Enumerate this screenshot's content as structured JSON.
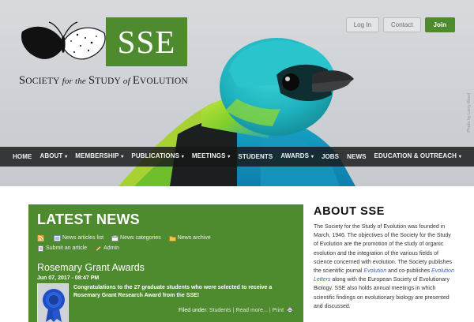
{
  "header": {
    "logo": {
      "abbr": "SSE",
      "tagline_parts": [
        "S",
        "OCIETY",
        " for the ",
        "S",
        "TUDY",
        " of ",
        "E",
        "VOLUTION"
      ]
    },
    "buttons": {
      "login": "Log In",
      "contact": "Contact",
      "join": "Join"
    },
    "photo_credit": "Photo by Larry Reed",
    "colors": {
      "brand_green": "#4e8a2e",
      "nav_bg": "#161616"
    }
  },
  "nav": [
    {
      "label": "HOME",
      "dropdown": false
    },
    {
      "label": "ABOUT",
      "dropdown": true
    },
    {
      "label": "MEMBERSHIP",
      "dropdown": true
    },
    {
      "label": "PUBLICATIONS",
      "dropdown": true
    },
    {
      "label": "MEETINGS",
      "dropdown": true
    },
    {
      "label": "STUDENTS",
      "dropdown": false
    },
    {
      "label": "AWARDS",
      "dropdown": true
    },
    {
      "label": "JOBS",
      "dropdown": false
    },
    {
      "label": "NEWS",
      "dropdown": false
    },
    {
      "label": "EDUCATION & OUTREACH",
      "dropdown": true
    }
  ],
  "news": {
    "title": "LATEST NEWS",
    "links": {
      "articles_list": "News articles list",
      "categories": "News categories",
      "archive": "News archive",
      "submit": "Submit an article",
      "admin": "Admin"
    },
    "article": {
      "title": "Rosemary Grant Awards",
      "date": "Jun 07, 2017 - 08:47 PM",
      "summary": "Congratulations to the 27 graduate students who were selected to receive a Rosemary Grant Research Award from the SSE!",
      "filed_under_label": "Filed under:",
      "category": "Students",
      "read_more": "Read more...",
      "print": "Print"
    }
  },
  "about": {
    "title": "ABOUT SSE",
    "text_1": "The Society for the Study of Evolution was founded in March, 1946. The objectives of the Society for the Study of Evolution are the promotion of the study of organic evolution and the integration of the various fields of science concerned with evolution. The Society publishes the scientific journal ",
    "journal_1": "Evolution",
    "text_2": " and co-publishes ",
    "journal_2": "Evolution Letters",
    "text_3": " along with the European Society of Evolutionary Biology. SSE also holds annual meetings in which scientific findings on evolutionary biology are presented and discussed."
  }
}
